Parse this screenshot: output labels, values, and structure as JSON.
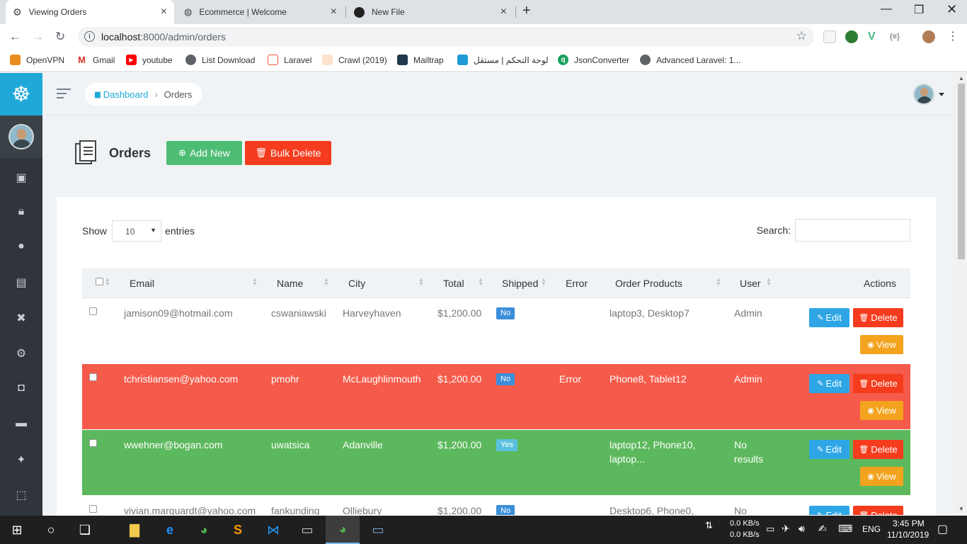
{
  "browser": {
    "tabs": [
      {
        "title": "Viewing Orders",
        "active": true
      },
      {
        "title": "Ecommerce | Welcome",
        "active": false
      },
      {
        "title": "New File",
        "active": false
      }
    ],
    "url_host": "localhost",
    "url_rest": ":8000/admin/orders",
    "bookmarks": [
      {
        "label": "OpenVPN",
        "color": "#ea8b1f"
      },
      {
        "label": "Gmail",
        "color": "#d93025"
      },
      {
        "label": "youtube",
        "color": "#ff0000"
      },
      {
        "label": "List Download",
        "color": "#5f6368"
      },
      {
        "label": "Laravel",
        "color": "#f05340"
      },
      {
        "label": "Crawl (2019)",
        "color": "#e67e22"
      },
      {
        "label": "Mailtrap",
        "color": "#1f3a4a"
      },
      {
        "label": "لوحة التحكم | مستقل",
        "color": "#1d9bd8"
      },
      {
        "label": "JsonConverter",
        "color": "#1aa260"
      },
      {
        "label": "Advanced Laravel: 1...",
        "color": "#5f6368"
      }
    ]
  },
  "app": {
    "breadcrumb": {
      "home": "Dashboard",
      "current": "Orders"
    },
    "page_title": "Orders",
    "add_new_label": "Add New",
    "bulk_delete_label": "Bulk Delete",
    "show_label": "Show",
    "entries_label": "entries",
    "entries_value": "10",
    "search_label": "Search:",
    "columns": [
      "Email",
      "Name",
      "City",
      "Total",
      "Shipped",
      "Error",
      "Order Products",
      "User",
      "Actions"
    ],
    "edit_label": "Edit",
    "delete_label": "Delete",
    "view_label": "View",
    "rows": [
      {
        "email": "jamison09@hotmail.com",
        "name": "cswaniawski",
        "city": "Harveyhaven",
        "total": "$1,200.00",
        "shipped": "No",
        "error": "",
        "products1": "laptop3, Desktop7",
        "products2": "",
        "user1": "Admin",
        "user2": "",
        "style": "default"
      },
      {
        "email": "tchristiansen@yahoo.com",
        "name": "pmohr",
        "city": "McLaughlinmouth",
        "total": "$1,200.00",
        "shipped": "No",
        "error": "Error",
        "products1": "Phone8, Tablet12",
        "products2": "",
        "user1": "Admin",
        "user2": "",
        "style": "red"
      },
      {
        "email": "wwehner@bogan.com",
        "name": "uwatsica",
        "city": "Adanville",
        "total": "$1,200.00",
        "shipped": "Yes",
        "error": "",
        "products1": "laptop12, Phone10,",
        "products2": "laptop...",
        "user1": "No",
        "user2": "results",
        "style": "green"
      },
      {
        "email": "vivian.marquardt@yahoo.com",
        "name": "fankunding",
        "city": "Olliebury",
        "total": "$1,200.00",
        "shipped": "No",
        "error": "",
        "products1": "Desktop6, Phone0,",
        "products2": "",
        "user1": "No",
        "user2": "",
        "style": "default"
      }
    ]
  },
  "taskbar": {
    "net_up": "0.0 KB/s",
    "net_down": "0.0 KB/s",
    "lang": "ENG",
    "time": "3:45 PM",
    "date": "11/10/2019"
  },
  "colors": {
    "brand": "#20a8d8",
    "success": "#4dbd74",
    "danger": "#f63c1e",
    "warning": "#f3a31e",
    "row_error": "#f55b4b",
    "row_shipped": "#5cb85c"
  }
}
